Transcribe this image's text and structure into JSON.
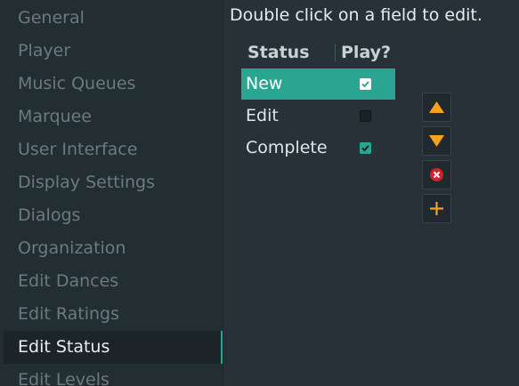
{
  "sidebar": {
    "items": [
      {
        "label": "General"
      },
      {
        "label": "Player"
      },
      {
        "label": "Music Queues"
      },
      {
        "label": "Marquee"
      },
      {
        "label": "User Interface"
      },
      {
        "label": "Display Settings"
      },
      {
        "label": "Dialogs"
      },
      {
        "label": "Organization"
      },
      {
        "label": "Edit Dances"
      },
      {
        "label": "Edit Ratings"
      },
      {
        "label": "Edit Status"
      },
      {
        "label": "Edit Levels"
      }
    ],
    "selected": "Edit Status"
  },
  "main": {
    "hint": "Double click on a field to edit.",
    "columns": {
      "status": "Status",
      "play": "Play?"
    },
    "rows": [
      {
        "status": "New",
        "play": true,
        "selected": true
      },
      {
        "status": "Edit",
        "play": false,
        "selected": false
      },
      {
        "status": "Complete",
        "play": true,
        "selected": false
      }
    ],
    "buttons": {
      "move_up_icon": "arrow-up-icon",
      "move_down_icon": "arrow-down-icon",
      "delete_icon": "delete-icon",
      "add_icon": "plus-icon"
    }
  },
  "colors": {
    "accent": "#2aa592",
    "background": "#263238",
    "sidebar": "#232e33",
    "arrow": "#f7a21b",
    "delete": "#d3202f"
  }
}
